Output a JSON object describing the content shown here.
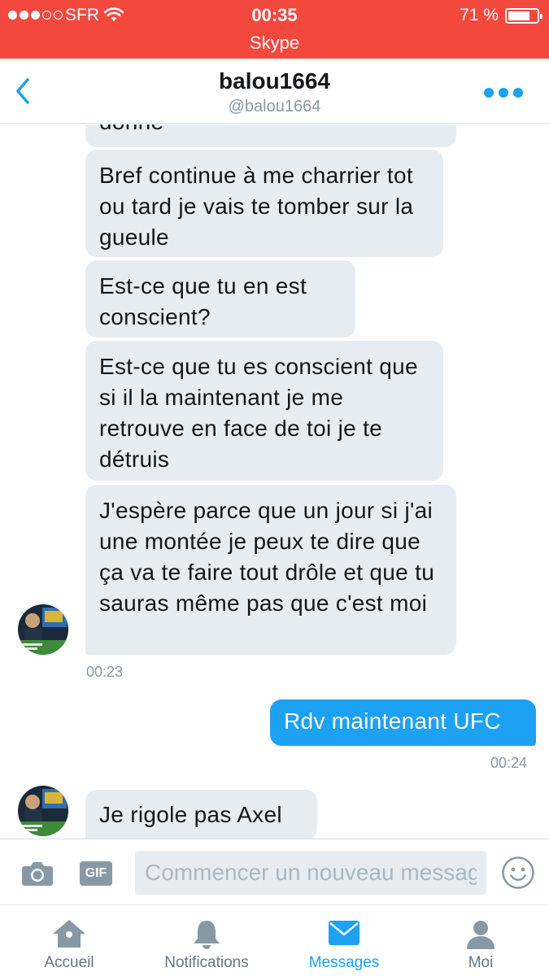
{
  "status_bar": {
    "carrier": "SFR",
    "time": "00:35",
    "battery": "71 %",
    "battery_level": 0.71,
    "app": "Skype"
  },
  "header": {
    "name": "balou1664",
    "handle": "@balou1664",
    "back_icon": "chevron-left-icon",
    "more_icon": "more-dots-icon"
  },
  "messages": [
    {
      "side": "received",
      "text": "donne"
    },
    {
      "side": "received",
      "text": "Bref continue à me charrier tot ou tard je vais te tomber sur la gueule"
    },
    {
      "side": "received",
      "text": "Est-ce que tu en est conscient?"
    },
    {
      "side": "received",
      "text": "Est-ce que tu es conscient que si il la maintenant je me retrouve en face de toi je te détruis"
    },
    {
      "side": "received",
      "text": "J'espère parce que un jour si j'ai une montée je peux te dire que ça va te faire tout drôle et que tu sauras même pas que c'est moi"
    },
    {
      "side": "sent",
      "text": "Rdv maintenant UFC"
    },
    {
      "side": "received",
      "text": "Je rigole pas Axel"
    }
  ],
  "timestamps": [
    "00:23",
    "00:24"
  ],
  "composer": {
    "gif_label": "GIF",
    "placeholder": "Commencer un nouveau message",
    "icons": [
      "camera-icon",
      "gif-icon",
      "emoji-icon"
    ]
  },
  "tabs": [
    {
      "label": "Accueil",
      "icon": "home-icon",
      "active": false
    },
    {
      "label": "Notifications",
      "icon": "bell-icon",
      "active": false
    },
    {
      "label": "Messages",
      "icon": "envelope-icon",
      "active": true
    },
    {
      "label": "Moi",
      "icon": "person-icon",
      "active": false
    }
  ],
  "colors": {
    "status_bar": "#f3483e",
    "accent": "#1da1f2",
    "bubble_received": "#e6ecf0",
    "muted": "#8899a6"
  }
}
